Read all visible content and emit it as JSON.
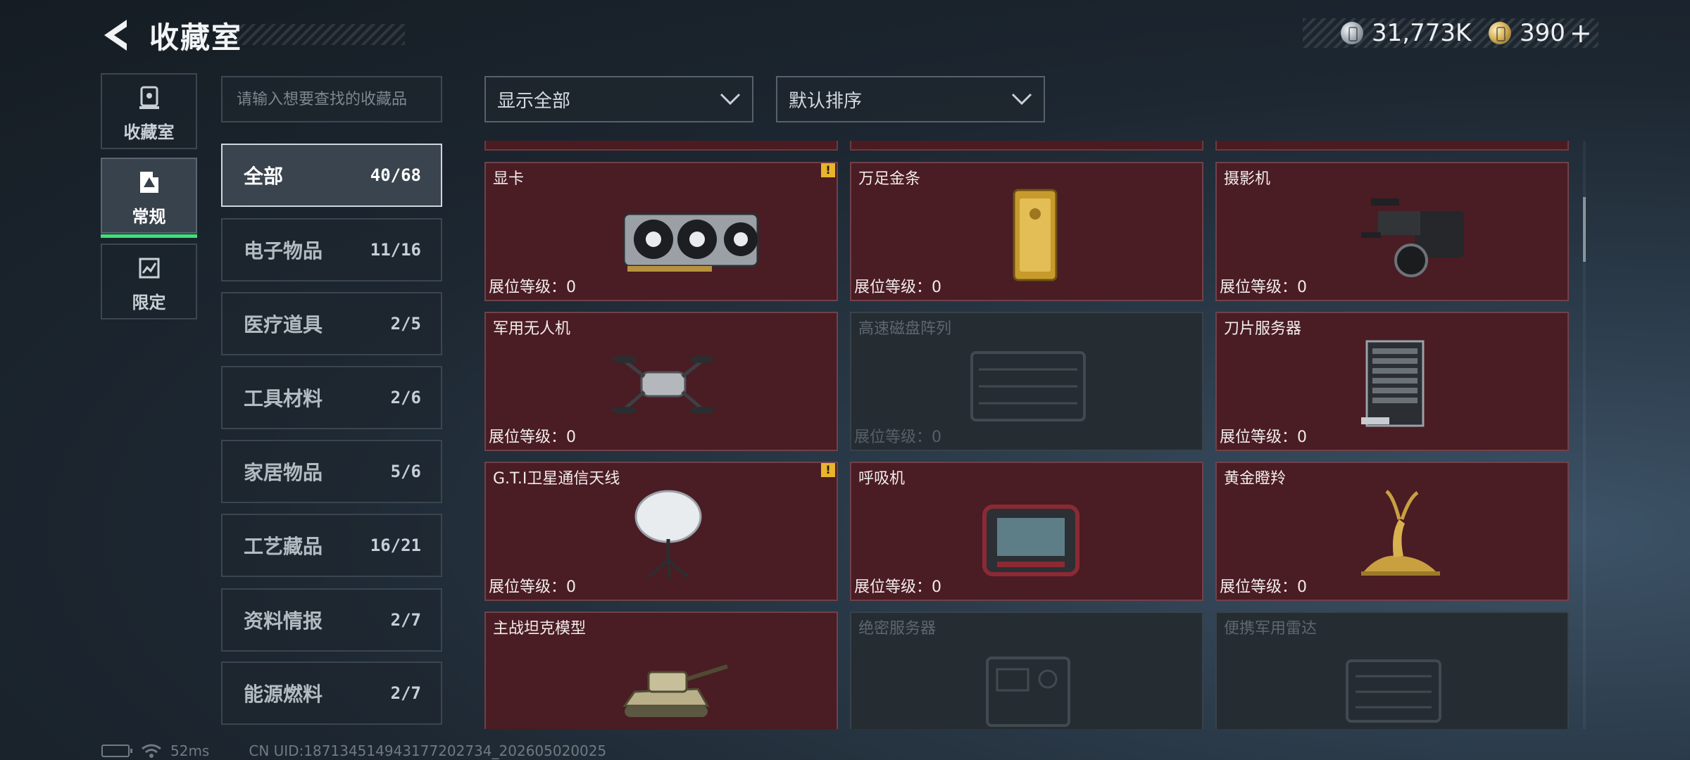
{
  "header": {
    "title": "收藏室",
    "currencies": [
      {
        "icon": "silver-coin-icon",
        "value": "31,773K"
      },
      {
        "icon": "gold-coin-icon",
        "value": "390"
      }
    ],
    "add_label": "+"
  },
  "side_tabs": [
    {
      "label": "收藏室",
      "icon": "collection-room-icon",
      "active": false
    },
    {
      "label": "常规",
      "icon": "regular-icon",
      "active": true
    },
    {
      "label": "限定",
      "icon": "limited-icon",
      "active": false
    }
  ],
  "search": {
    "placeholder": "请输入想要查找的收藏品",
    "value": ""
  },
  "categories": [
    {
      "name": "全部",
      "count": "40/68",
      "active": true
    },
    {
      "name": "电子物品",
      "count": "11/16"
    },
    {
      "name": "医疗道具",
      "count": "2/5"
    },
    {
      "name": "工具材料",
      "count": "2/6"
    },
    {
      "name": "家居物品",
      "count": "5/6"
    },
    {
      "name": "工艺藏品",
      "count": "16/21"
    },
    {
      "name": "资料情报",
      "count": "2/7"
    },
    {
      "name": "能源燃料",
      "count": "2/7"
    }
  ],
  "filters": {
    "show": "显示全部",
    "sort": "默认排序"
  },
  "items": [
    {
      "name": "显卡",
      "level": "展位等级：0",
      "unlocked": true,
      "alert": true,
      "icon": "graphics-card-icon"
    },
    {
      "name": "万足金条",
      "level": "展位等级：0",
      "unlocked": true,
      "alert": false,
      "icon": "gold-bar-icon"
    },
    {
      "name": "摄影机",
      "level": "展位等级：0",
      "unlocked": true,
      "alert": false,
      "icon": "camera-icon"
    },
    {
      "name": "军用无人机",
      "level": "展位等级：0",
      "unlocked": true,
      "alert": false,
      "icon": "drone-icon"
    },
    {
      "name": "高速磁盘阵列",
      "level": "展位等级：0",
      "unlocked": false,
      "alert": false,
      "icon": "disk-array-icon"
    },
    {
      "name": "刀片服务器",
      "level": "展位等级：0",
      "unlocked": true,
      "alert": false,
      "icon": "blade-server-icon"
    },
    {
      "name": "G.T.I卫星通信天线",
      "level": "展位等级：0",
      "unlocked": true,
      "alert": true,
      "icon": "satellite-dish-icon"
    },
    {
      "name": "呼吸机",
      "level": "展位等级：0",
      "unlocked": true,
      "alert": false,
      "icon": "ventilator-icon"
    },
    {
      "name": "黄金瞪羚",
      "level": "展位等级：0",
      "unlocked": true,
      "alert": false,
      "icon": "golden-gazelle-icon"
    },
    {
      "name": "主战坦克模型",
      "level": "",
      "unlocked": true,
      "alert": false,
      "icon": "tank-model-icon"
    },
    {
      "name": "绝密服务器",
      "level": "",
      "unlocked": false,
      "alert": false,
      "icon": "secret-server-icon"
    },
    {
      "name": "便携军用雷达",
      "level": "",
      "unlocked": false,
      "alert": false,
      "icon": "radar-icon"
    }
  ],
  "alert_symbol": "!",
  "footer": {
    "ping": "52ms",
    "uid": "CN UID:18713451494317720273‌4_202605020025"
  },
  "colors": {
    "unlocked_card": "#4a1c23",
    "locked_card": "#252d33",
    "active_tab_indicator": "#3ee07a",
    "alert_badge": "#e8b52c"
  }
}
